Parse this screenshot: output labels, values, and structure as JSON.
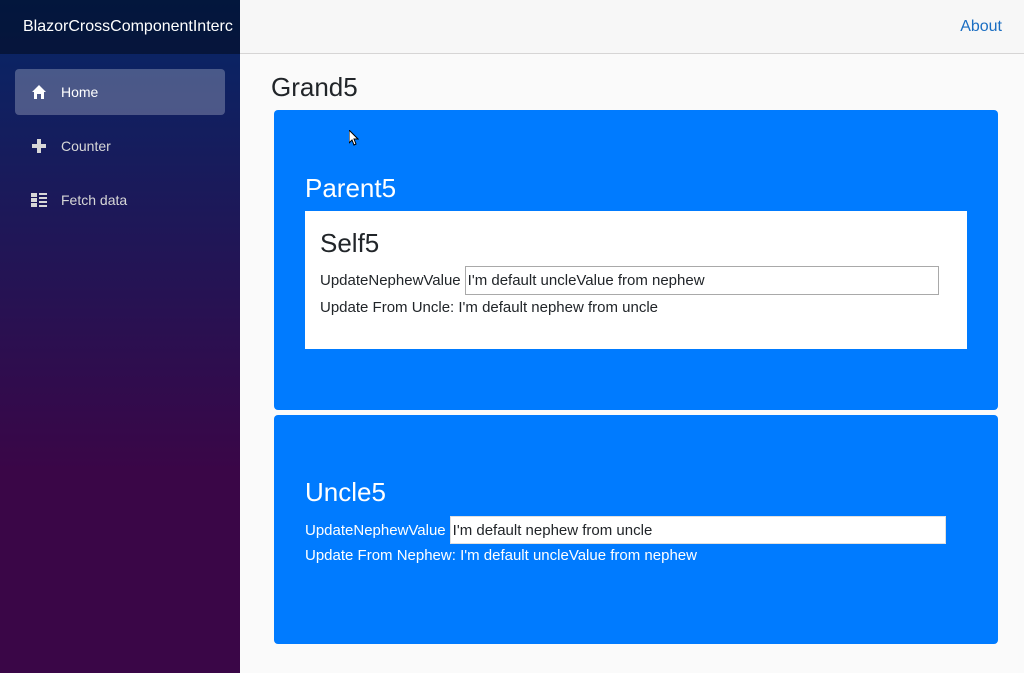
{
  "sidebar": {
    "brand": "BlazorCrossComponentInterc",
    "items": [
      {
        "label": "Home",
        "icon": "home-icon",
        "active": true
      },
      {
        "label": "Counter",
        "icon": "plus-icon",
        "active": false
      },
      {
        "label": "Fetch data",
        "icon": "list-icon",
        "active": false
      }
    ]
  },
  "topbar": {
    "about": "About"
  },
  "page": {
    "title": "Grand5"
  },
  "parent": {
    "title": "Parent5",
    "self": {
      "title": "Self5",
      "field_label": "UpdateNephewValue",
      "field_value": "I'm default uncleValue from nephew",
      "info": "Update From Uncle: I'm default nephew from uncle"
    }
  },
  "uncle": {
    "title": "Uncle5",
    "field_label": "UpdateNephewValue",
    "field_value": "I'm default nephew from uncle",
    "info": "Update From Nephew: I'm default uncleValue from nephew"
  },
  "colors": {
    "panel": "#007bff",
    "link": "#1b6ec2",
    "sidebar_top": "#052767",
    "sidebar_bottom": "#3a0647"
  }
}
